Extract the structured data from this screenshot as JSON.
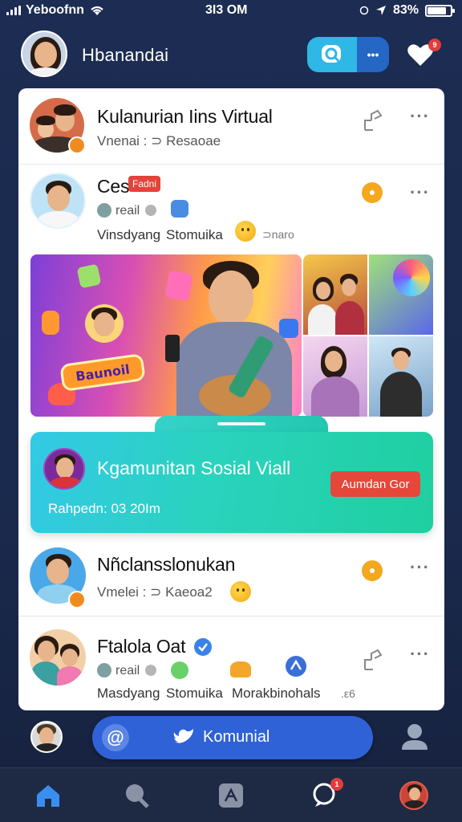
{
  "status_bar": {
    "carrier": "Yeboofnn",
    "time": "3I3 OM",
    "battery": "83%",
    "battery_level": 0.83
  },
  "header": {
    "title": "Hbanandai",
    "search_label": "search",
    "more_label": "•••",
    "notification_count": "9"
  },
  "feed": [
    {
      "title": "Kulanurian Iins Virtual",
      "subtitle": "Vnenai : ⊃ Resaoae"
    },
    {
      "title": "Ces",
      "tag": "Fadni",
      "reaction_text": "reail",
      "meta_left": "Vinsdyang",
      "meta_mid": "Stomuika",
      "meta_right": "⊃naro"
    },
    {
      "title": "Nñclansslonukan",
      "subtitle": "Vmelei : ⊃ Kaeoa2"
    },
    {
      "title": "Ftalola Oat",
      "reaction_text": "reail",
      "meta_left": "Masdyang",
      "meta_mid": "Stomuika",
      "meta_right": "Morakbinohals",
      "meta_extra": ".ε6"
    }
  ],
  "media": {
    "logo_text": "Baunoil"
  },
  "banner": {
    "title": "Kgamunitan Sosial Viall",
    "time": "Rahpedn: 03 20Im",
    "button_label": "Aumdan Gor"
  },
  "composer": {
    "label": "Komunial",
    "at_symbol": "@"
  },
  "tabbar": {
    "messages_badge": "1"
  },
  "colors": {
    "accent_blue": "#2f62d6",
    "banner_green": "#2ad3bd",
    "alert_red": "#e5473a",
    "background": "#1c2c52"
  }
}
